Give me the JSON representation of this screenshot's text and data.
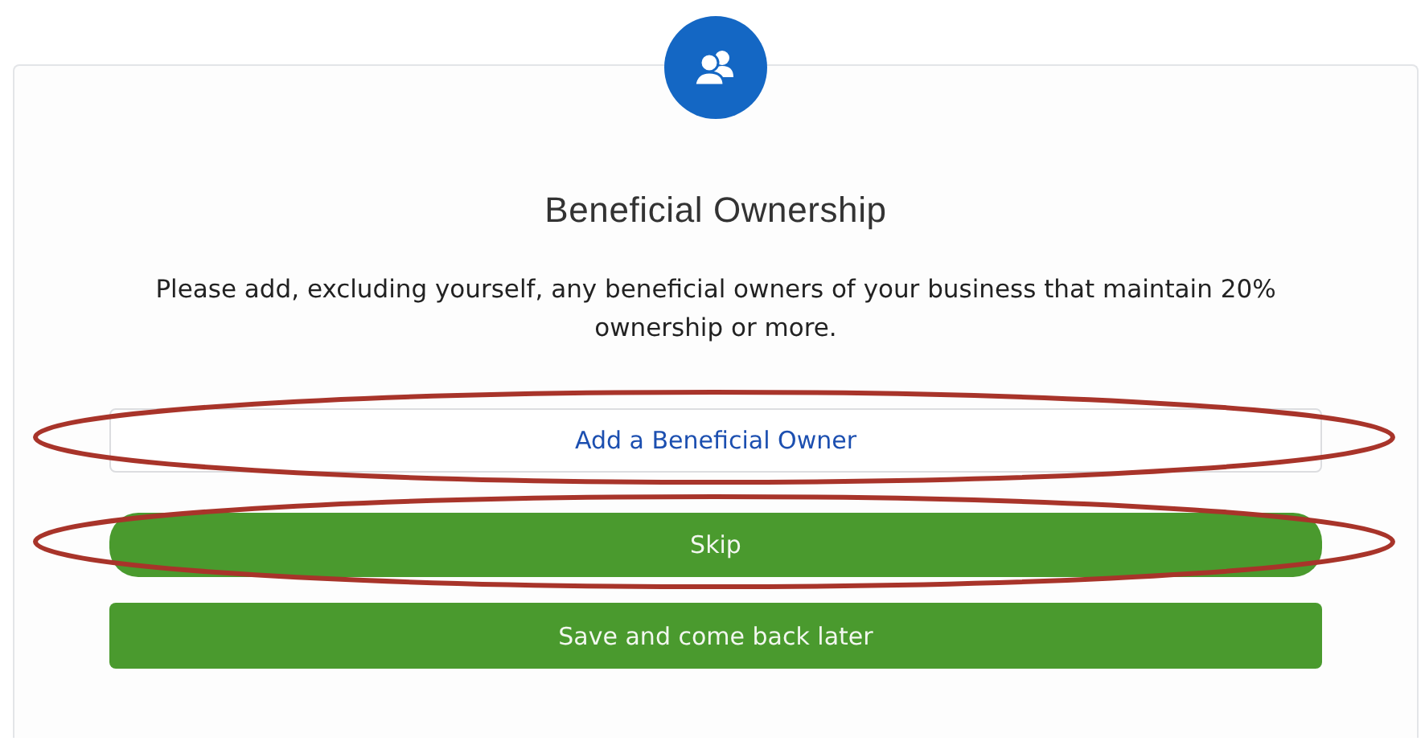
{
  "card": {
    "title": "Beneficial Ownership",
    "description": "Please add, excluding yourself, any beneficial owners of your business that maintain 20% ownership or more.",
    "buttons": [
      {
        "label": "Add a Beneficial Owner",
        "kind": "outline",
        "highlighted": true
      },
      {
        "label": "Skip",
        "kind": "pill",
        "highlighted": true
      },
      {
        "label": "Save and come back later",
        "kind": "solid",
        "highlighted": false
      }
    ]
  }
}
